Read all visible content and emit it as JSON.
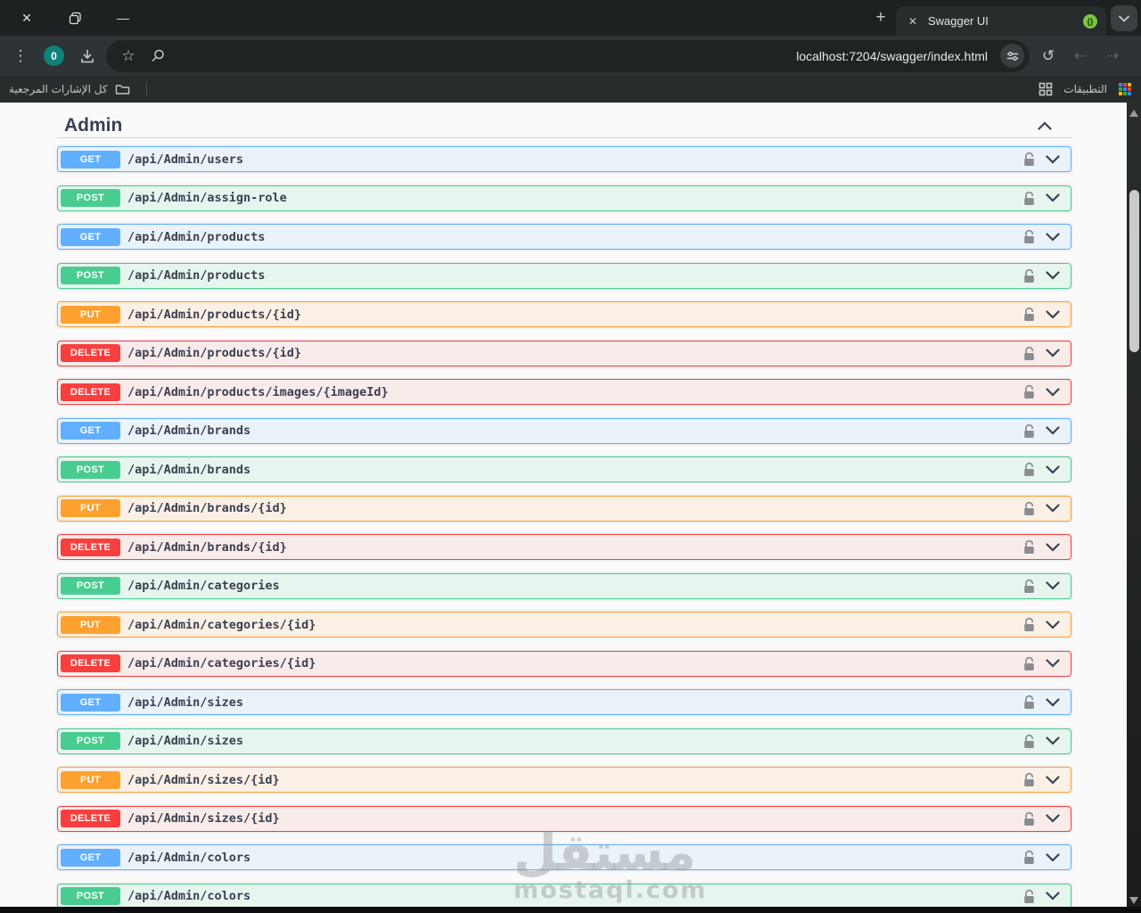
{
  "browser": {
    "window_controls": {
      "close": "✕",
      "restore": "❐",
      "minimize": "—"
    },
    "new_tab_label": "+",
    "tab": {
      "close": "✕",
      "title": "Swagger UI",
      "favicon_glyph": "{}"
    },
    "toolbar": {
      "menu_icon": "⋮",
      "download_badge": "0",
      "star_icon": "☆",
      "url": "localhost:7204/swagger/index.html",
      "reload_icon": "↺",
      "back_icon": "⇠",
      "forward_icon": "⇢"
    },
    "bookmarks": {
      "all_bookmarks_label": "كل الإشارات المرجعية",
      "apps_label": "التطبيقات"
    }
  },
  "page": {
    "section_title": "Admin",
    "endpoints": [
      {
        "method": "GET",
        "path": "/api/Admin/users"
      },
      {
        "method": "POST",
        "path": "/api/Admin/assign-role"
      },
      {
        "method": "GET",
        "path": "/api/Admin/products"
      },
      {
        "method": "POST",
        "path": "/api/Admin/products"
      },
      {
        "method": "PUT",
        "path": "/api/Admin/products/{id}"
      },
      {
        "method": "DELETE",
        "path": "/api/Admin/products/{id}"
      },
      {
        "method": "DELETE",
        "path": "/api/Admin/products/images/{imageId}"
      },
      {
        "method": "GET",
        "path": "/api/Admin/brands"
      },
      {
        "method": "POST",
        "path": "/api/Admin/brands"
      },
      {
        "method": "PUT",
        "path": "/api/Admin/brands/{id}"
      },
      {
        "method": "DELETE",
        "path": "/api/Admin/brands/{id}"
      },
      {
        "method": "POST",
        "path": "/api/Admin/categories"
      },
      {
        "method": "PUT",
        "path": "/api/Admin/categories/{id}"
      },
      {
        "method": "DELETE",
        "path": "/api/Admin/categories/{id}"
      },
      {
        "method": "GET",
        "path": "/api/Admin/sizes"
      },
      {
        "method": "POST",
        "path": "/api/Admin/sizes"
      },
      {
        "method": "PUT",
        "path": "/api/Admin/sizes/{id}"
      },
      {
        "method": "DELETE",
        "path": "/api/Admin/sizes/{id}"
      },
      {
        "method": "GET",
        "path": "/api/Admin/colors"
      },
      {
        "method": "POST",
        "path": "/api/Admin/colors"
      }
    ],
    "watermark": {
      "arabic": "مستقل",
      "latin": "mostaql.com"
    }
  },
  "colors": {
    "get": "#61affe",
    "post": "#49cc90",
    "put": "#fca130",
    "delete": "#f93e3e",
    "favicon_green": "#7cc642",
    "download_badge_teal": "#0e8276",
    "chrome_dark": "#1d2122",
    "toolbar": "#2e3335",
    "content_bg": "#fafafa"
  }
}
